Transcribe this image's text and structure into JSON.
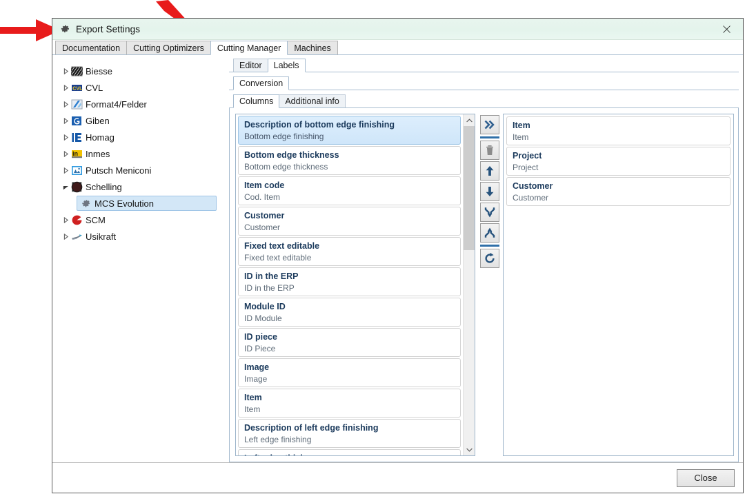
{
  "window": {
    "title": "Export Settings",
    "gear_icon": "gear-icon",
    "close_icon": "close-icon",
    "accent": "#2f6fa8",
    "titlebar_color": "#e6f4ec"
  },
  "main_tabs": [
    {
      "label": "Documentation",
      "active": false
    },
    {
      "label": "Cutting Optimizers",
      "active": false
    },
    {
      "label": "Cutting Manager",
      "active": true
    },
    {
      "label": "Machines",
      "active": false
    }
  ],
  "tree": [
    {
      "label": "Biesse",
      "icon": "biesse-icon",
      "expanded": false,
      "child": false,
      "selected": false
    },
    {
      "label": "CVL",
      "icon": "cvl-icon",
      "expanded": false,
      "child": false,
      "selected": false
    },
    {
      "label": "Format4/Felder",
      "icon": "format4-icon",
      "expanded": false,
      "child": false,
      "selected": false
    },
    {
      "label": "Giben",
      "icon": "giben-icon",
      "expanded": false,
      "child": false,
      "selected": false
    },
    {
      "label": "Homag",
      "icon": "homag-icon",
      "expanded": false,
      "child": false,
      "selected": false
    },
    {
      "label": "Inmes",
      "icon": "inmes-icon",
      "expanded": false,
      "child": false,
      "selected": false
    },
    {
      "label": "Putsch Meniconi",
      "icon": "putsch-meniconi-icon",
      "expanded": false,
      "child": false,
      "selected": false
    },
    {
      "label": "Schelling",
      "icon": "schelling-icon",
      "expanded": true,
      "child": false,
      "selected": false
    },
    {
      "label": "MCS Evolution",
      "icon": "gear-icon",
      "expanded": null,
      "child": true,
      "selected": true
    },
    {
      "label": "SCM",
      "icon": "scm-icon",
      "expanded": false,
      "child": false,
      "selected": false
    },
    {
      "label": "Usikraft",
      "icon": "usikraft-icon",
      "expanded": false,
      "child": false,
      "selected": false
    }
  ],
  "sub_tabs_level2": [
    {
      "label": "Editor",
      "active": false
    },
    {
      "label": "Labels",
      "active": true
    }
  ],
  "sub_tabs_level3": [
    {
      "label": "Conversion",
      "active": true
    }
  ],
  "sub_tabs_level4": [
    {
      "label": "Columns",
      "active": true
    },
    {
      "label": "Additional info",
      "active": false
    }
  ],
  "available_columns": [
    {
      "title": "Description of bottom edge finishing",
      "sub": "Bottom edge finishing",
      "selected": true
    },
    {
      "title": "Bottom edge thickness",
      "sub": "Bottom edge thickness",
      "selected": false
    },
    {
      "title": "Item code",
      "sub": "Cod. Item",
      "selected": false
    },
    {
      "title": "Customer",
      "sub": "Customer",
      "selected": false
    },
    {
      "title": "Fixed text editable",
      "sub": "Fixed text editable",
      "selected": false
    },
    {
      "title": "ID in the ERP",
      "sub": "ID in the ERP",
      "selected": false
    },
    {
      "title": "Module ID",
      "sub": "ID Module",
      "selected": false
    },
    {
      "title": "ID piece",
      "sub": "ID Piece",
      "selected": false
    },
    {
      "title": "Image",
      "sub": "Image",
      "selected": false
    },
    {
      "title": "Item",
      "sub": "Item",
      "selected": false
    },
    {
      "title": "Description of left edge finishing",
      "sub": "Left edge finishing",
      "selected": false
    },
    {
      "title": "Left edge thickness",
      "sub": "",
      "selected": false
    }
  ],
  "selected_columns": [
    {
      "title": "Item",
      "sub": "Item"
    },
    {
      "title": "Project",
      "sub": "Project"
    },
    {
      "title": "Customer",
      "sub": "Customer"
    }
  ],
  "toolbar_buttons": [
    {
      "name": "add-all-button",
      "icon": "double-chevron-right-icon",
      "separator_after": true
    },
    {
      "name": "delete-button",
      "icon": "trash-icon",
      "separator_after": false
    },
    {
      "name": "move-up-button",
      "icon": "arrow-up-icon",
      "separator_after": false
    },
    {
      "name": "move-down-button",
      "icon": "arrow-down-icon",
      "separator_after": false
    },
    {
      "name": "merge-button",
      "icon": "merge-arrows-icon",
      "separator_after": false
    },
    {
      "name": "split-button",
      "icon": "split-arrows-icon",
      "separator_after": true
    },
    {
      "name": "refresh-button",
      "icon": "refresh-icon",
      "separator_after": false
    }
  ],
  "footer": {
    "close_label": "Close"
  },
  "scrollbar": {
    "up_icon": "chevron-up-icon",
    "down_icon": "chevron-down-icon"
  }
}
